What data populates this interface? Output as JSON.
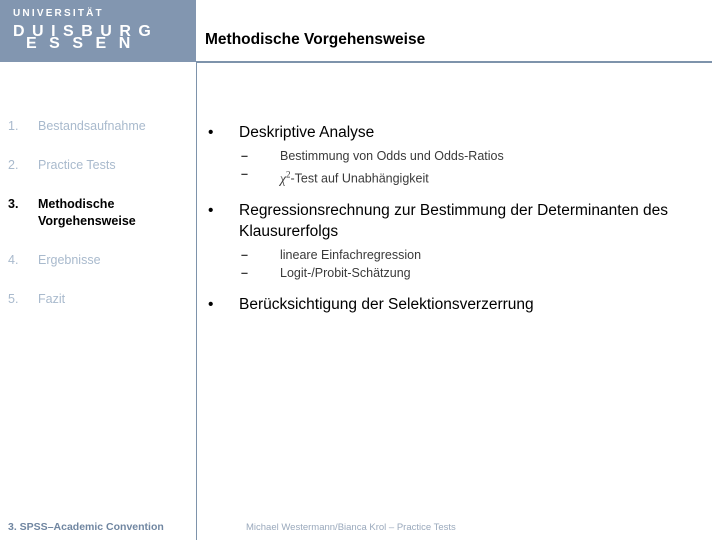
{
  "logo": {
    "line1": "UNIVERSITÄT",
    "line2": "DUISBURG",
    "line3": "ESSEN",
    "background_color": "#8296b0",
    "text_color": "#ffffff"
  },
  "header": {
    "title": "Methodische Vorgehensweise",
    "rule_color": "#7e93ab"
  },
  "sidebar": {
    "items": [
      {
        "number": "1.",
        "label": "Bestandsaufnahme",
        "active": false
      },
      {
        "number": "2.",
        "label": "Practice Tests",
        "active": false
      },
      {
        "number": "3.",
        "label": "Methodische\nVorgehensweise",
        "active": true
      },
      {
        "number": "4.",
        "label": "Ergebnisse",
        "active": false
      },
      {
        "number": "5.",
        "label": "Fazit",
        "active": false
      }
    ],
    "active_color": "#000000",
    "inactive_color": "#a9bacd"
  },
  "content": {
    "bullet_marker": "•",
    "sub_marker": "–",
    "groups": [
      {
        "heading": "Deskriptive Analyse",
        "subs": [
          {
            "text": "Bestimmung von Odds und Odds-Ratios",
            "has_chi": false
          },
          {
            "text": "-Test auf Unabhängigkeit",
            "has_chi": true,
            "chi_symbol": "χ",
            "chi_exponent": "2"
          }
        ]
      },
      {
        "heading": "Regressionsrechnung zur Bestimmung der Determinanten des Klausurerfolgs",
        "subs": [
          {
            "text": "lineare Einfachregression",
            "has_chi": false
          },
          {
            "text": "Logit-/Probit-Schätzung",
            "has_chi": false
          }
        ]
      },
      {
        "heading": "Berücksichtigung der Selektionsverzerrung",
        "subs": []
      }
    ]
  },
  "footer": {
    "left": "3. SPSS–Academic Convention",
    "right": "Michael Westermann/Bianca Krol – Practice Tests",
    "left_color": "#7086a1",
    "right_color": "#9aa9bc"
  }
}
